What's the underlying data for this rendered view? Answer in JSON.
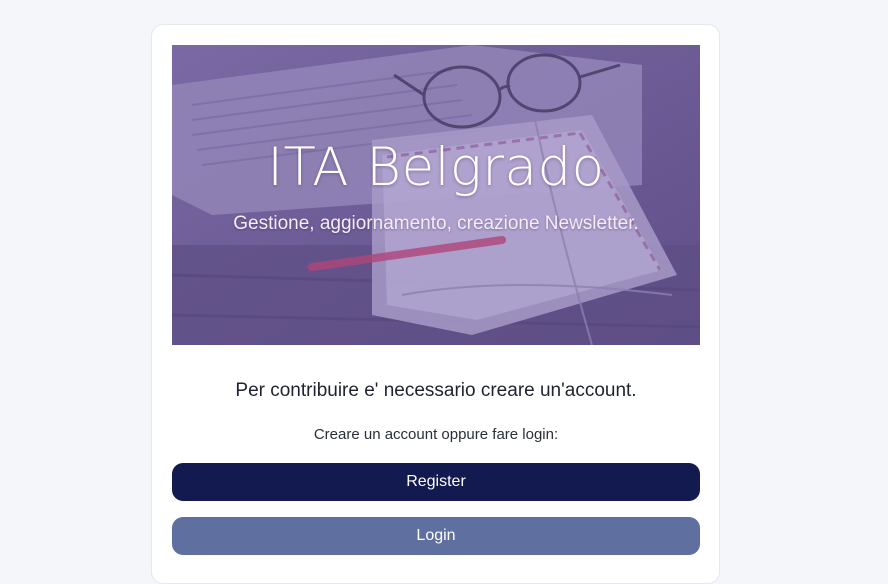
{
  "hero": {
    "title": "ITA Belgrado",
    "subtitle": "Gestione, aggiornamento, creazione Newsletter."
  },
  "content": {
    "lead": "Per contribuire e' necessario creare un'account.",
    "instruction": "Creare un account oppure fare login:"
  },
  "buttons": {
    "register_label": "Register",
    "login_label": "Login"
  },
  "colors": {
    "page_bg": "#f5f6fa",
    "hero_overlay": "#6f5c9a",
    "register_bg": "#121a4f",
    "login_bg": "#5f6f9f"
  }
}
